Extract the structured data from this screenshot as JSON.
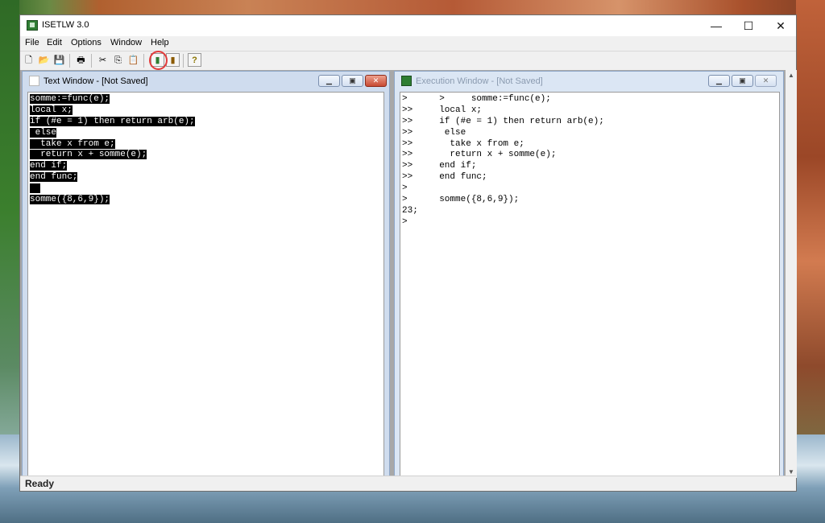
{
  "window": {
    "title": "ISETLW 3.0",
    "controls": {
      "minimize": "—",
      "maximize": "☐",
      "close": "✕"
    }
  },
  "menu": [
    "File",
    "Edit",
    "Options",
    "Window",
    "Help"
  ],
  "toolbar": {
    "buttons": [
      {
        "name": "new-icon",
        "glyph": "🗋"
      },
      {
        "name": "open-icon",
        "glyph": "📂"
      },
      {
        "name": "save-icon",
        "glyph": "💾"
      },
      {
        "name": "print-icon",
        "glyph": "🖶"
      },
      {
        "name": "cut-icon",
        "glyph": "✂"
      },
      {
        "name": "copy-icon",
        "glyph": "⎘"
      },
      {
        "name": "paste-icon",
        "glyph": "📋"
      },
      {
        "name": "run-icon",
        "glyph": "▮"
      },
      {
        "name": "run-selection-icon",
        "glyph": "▮"
      },
      {
        "name": "help-icon",
        "glyph": "?"
      }
    ],
    "annotation_color": "#e23b3b"
  },
  "text_window": {
    "title": "Text Window - [Not Saved]",
    "lines": [
      "somme:=func(e);",
      "local x;",
      "if (#e = 1) then return arb(e);",
      " else",
      "  take x from e;",
      "  return x + somme(e);",
      "end if;",
      "end func;",
      "",
      "somme({8,6,9});"
    ]
  },
  "exec_window": {
    "title": "Execution Window - [Not Saved]",
    "lines": [
      ">      >     somme:=func(e);",
      ">>     local x;",
      ">>     if (#e = 1) then return arb(e);",
      ">>      else",
      ">>       take x from e;",
      ">>       return x + somme(e);",
      ">>     end if;",
      ">>     end func;",
      ">",
      ">      somme({8,6,9});",
      "23;",
      ">"
    ]
  },
  "statusbar": {
    "text": "Ready"
  },
  "colors": {
    "selection": "#000000",
    "mdi_background": "#a8a8a8",
    "close_button": "#c84a33"
  }
}
